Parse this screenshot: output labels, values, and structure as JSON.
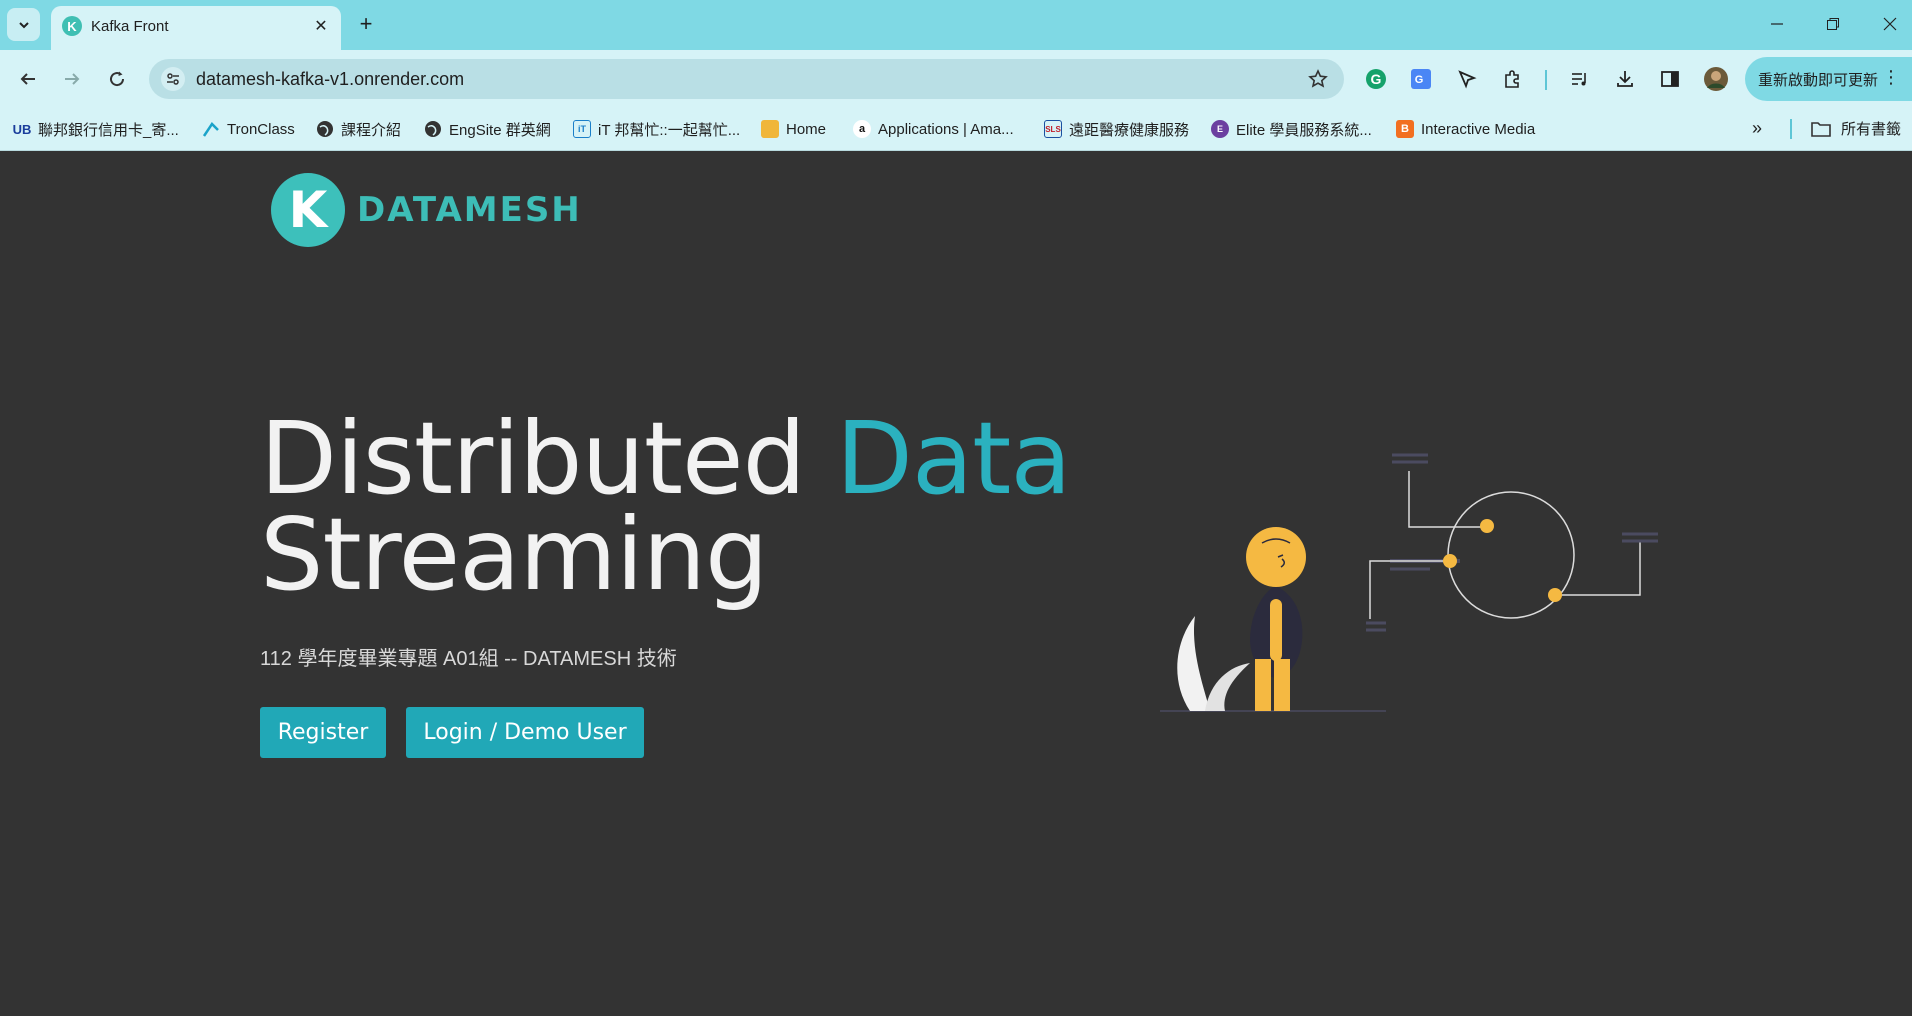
{
  "browser": {
    "tab": {
      "title": "Kafka Front",
      "favicon_letter": "K"
    },
    "url": "datamesh-kafka-v1.onrender.com",
    "update_button": "重新啟動即可更新",
    "bookmarks": [
      {
        "label": "聯邦銀行信用卡_寄...",
        "icon": "UB"
      },
      {
        "label": "TronClass",
        "icon": "tronclass-icon"
      },
      {
        "label": "課程介紹",
        "icon": "globe-icon"
      },
      {
        "label": "EngSite 群英網",
        "icon": "globe-icon"
      },
      {
        "label": "iT 邦幫忙::一起幫忙...",
        "icon": "ithome-icon"
      },
      {
        "label": "Home",
        "icon": "box-icon"
      },
      {
        "label": "Applications | Ama...",
        "icon": "amazon-icon"
      },
      {
        "label": "遠距醫療健康服務",
        "icon": "sls-icon"
      },
      {
        "label": "Elite 學員服務系統...",
        "icon": "elite-icon"
      },
      {
        "label": "Interactive Media",
        "icon": "blogger-icon"
      }
    ],
    "all_bookmarks": "所有書籤"
  },
  "page": {
    "logo_letter": "K",
    "logo_text": "DATAMESH",
    "hero": {
      "title_part1": "Distributed ",
      "title_accent": "Data",
      "title_part2": "Streaming",
      "subtitle": "112 學年度畢業專題 A01組 -- DATAMESH 技術"
    },
    "buttons": {
      "register": "Register",
      "login": "Login / Demo User"
    }
  },
  "colors": {
    "accent": "#2bb1bf",
    "background": "#333333",
    "illustration_yellow": "#f5b942"
  }
}
